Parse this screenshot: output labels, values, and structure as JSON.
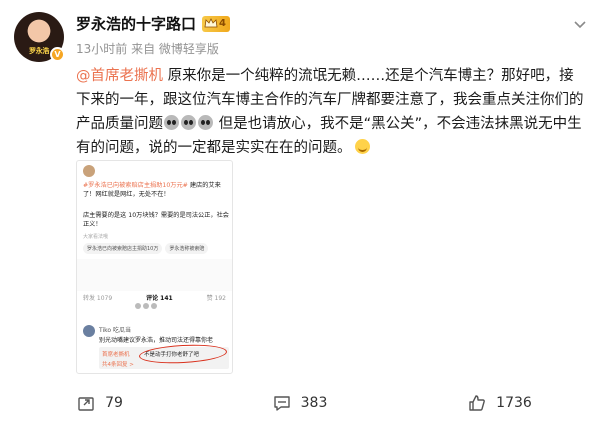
{
  "author": {
    "name": "罗永浩的十字路口",
    "avatar_caption": "罗永浩",
    "level": "4"
  },
  "meta": {
    "time": "13小时前",
    "source": "来自 微博轻享版"
  },
  "post": {
    "mention": "@首席老撕机",
    "text": " 原来你是一个纯粹的流氓无赖……还是个汽车博主？那好吧，接下来的一年，跟这位汽车博主合作的汽车厂牌都要注意了，我会重点关注你们的产品质量问题",
    "text2": " 但是也请放心，我不是“黑公关”，不会违法抹黑说无中生有的问题，说的一定都是实实在在的问题。"
  },
  "embedded": {
    "line1_topic": "#罗永浩已向被索赔店主捐助10万元#",
    "line1_rest": " 建店的艾来了！网红就是网红，无处不在！",
    "line2": "店主需要的是这 10万块钱？需要的是司法公正，社会正义！",
    "small": "大家看法哦",
    "chip1": "罗永浩已向被索赔店主捐助10万",
    "chip2": "罗永浩称被索赔",
    "tab_repost": "转发 1079",
    "tab_comment": "评论 141",
    "tab_like": "赞 192",
    "commenter": "Tiko 吃瓜当",
    "comment": "别光动嘴建议罗永浩，推动司法还得靠你老",
    "reply_name": "首席老撕机",
    "reply_text": "不是动手打你老舒了吧",
    "reply_more": "共4条回复 >"
  },
  "actions": {
    "repost": "79",
    "comment": "383",
    "like": "1736"
  }
}
